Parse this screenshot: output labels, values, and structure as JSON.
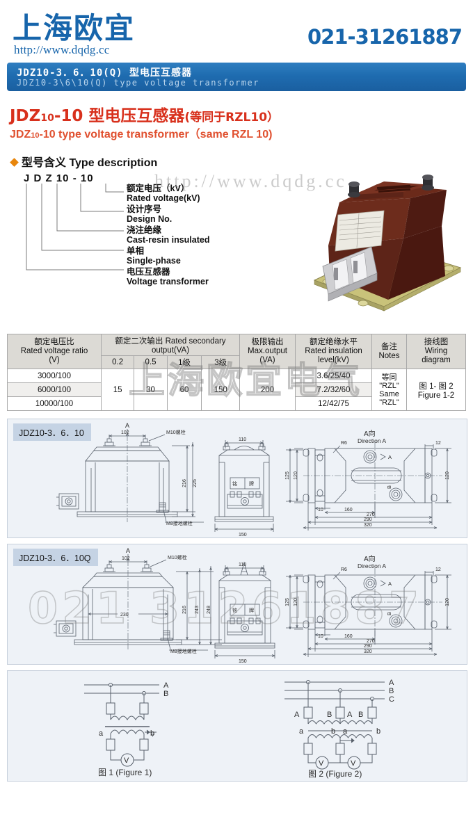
{
  "header": {
    "company_cn": "上海欧宜",
    "website": "http://www.dqdg.cc",
    "phone": "021-31261887",
    "brand_color": "#1765ab"
  },
  "bluebar": {
    "title_cn": "JDZ10-3．6．10(Q)  型电压互感器",
    "title_en": "JDZ10-3\\6\\10(Q)  type  voltage  transformer",
    "bg_color": "#1f6cb0"
  },
  "product": {
    "title_cn_prefix": "JDZ",
    "title_cn_sub": "10",
    "title_cn_main": "-10  型电压互感器",
    "title_cn_tail": "(等同于RZL10）",
    "title_en_prefix": "JDZ",
    "title_en_sub": "10",
    "title_en_main": "-10  type voltage  transformer（same RZL 10)",
    "title_color": "#d8301c"
  },
  "type_description": {
    "heading": "型号含义 Type description",
    "code": "J   D   Z  10  -   10",
    "items": [
      {
        "cn": "额定电压（kV）",
        "en": "Rated voltage(kV)"
      },
      {
        "cn": "设计序号",
        "en": "Design No."
      },
      {
        "cn": "浇注绝缘",
        "en": "Cast-resin insulated"
      },
      {
        "cn": "单相",
        "en": "Single-phase"
      },
      {
        "cn": "电压互感器",
        "en": "Voltage transformer"
      }
    ]
  },
  "watermarks": {
    "url": "http://www.dqdg.cc",
    "phone": "021 31261887",
    "company": "上海欧宜电气"
  },
  "spec_table": {
    "headers": {
      "ratio_cn": "额定电压比",
      "ratio_en": "Rated voltage ratio",
      "ratio_unit": "(V)",
      "secondary_output": "额定二次输出 Rated secondary output(VA)",
      "classes": [
        "0.2",
        "0.5",
        "1级",
        "3级"
      ],
      "max_output_cn": "极限输出",
      "max_output_en": "Max.output",
      "max_output_unit": "(VA)",
      "insulation_cn": "额定绝缘水平",
      "insulation_en": "Rated insulation",
      "insulation_unit": "level(kV)",
      "notes_cn": "备注",
      "notes_en": "Notes",
      "wiring_cn": "接线图",
      "wiring_en1": "Wiring",
      "wiring_en2": "diagram"
    },
    "rows": [
      {
        "ratio": "3000/100",
        "insulation": "3.6/25/40"
      },
      {
        "ratio": "6000/100",
        "insulation": "7.2/32/60"
      },
      {
        "ratio": "10000/100",
        "insulation": "12/42/75"
      }
    ],
    "merged": {
      "class_02": "15",
      "class_05": "30",
      "class_1": "60",
      "class_3": "150",
      "max_output": "200",
      "notes_line1": "等同",
      "notes_line2": "\"RZL\"",
      "notes_line3": "Same",
      "notes_line4": "\"RZL\"",
      "wiring_line1": "图 1- 图 2",
      "wiring_line2": "Figure 1-2"
    }
  },
  "drawing_panel_1": {
    "label": "JDZ10-3．6．10",
    "front_view": {
      "marker_a": "A",
      "dim_102": "102",
      "bolt_label": "M10螺栓",
      "dim_216": "216",
      "dim_225": "225",
      "ground_label": "M8接地螺栓"
    },
    "side_view": {
      "dim_110": "110",
      "nameplate": "铭   牌",
      "dim_150": "150"
    },
    "top_view": {
      "direction_cn": "A向",
      "direction_en": "Direction A",
      "r6": "R6",
      "dim_12": "12",
      "dim_125": "125",
      "dim_120_left": "120",
      "dim_120_right": "120",
      "dim_10": "10",
      "dim_160": "160",
      "dim_270": "270",
      "dim_290": "290",
      "dim_320": "320",
      "label_a": "A",
      "label_b": "B"
    }
  },
  "drawing_panel_2": {
    "label": "JDZ10-3．6．10Q",
    "front_view": {
      "marker_a": "A",
      "dim_102": "102",
      "bolt_label": "M10螺栓",
      "dim_230": "230",
      "dim_216": "216",
      "dim_243": "243",
      "dim_248": "248",
      "ground_label": "M8接地螺栓"
    },
    "side_view": {
      "dim_110": "110",
      "nameplate": "铭   牌",
      "dim_150": "150"
    },
    "top_view": {
      "direction_cn": "A向",
      "direction_en": "Direction A",
      "r6": "R6",
      "dim_12": "12",
      "dim_125": "125",
      "dim_120_left": "120",
      "dim_120_right": "120",
      "dim_10": "10",
      "dim_160": "160",
      "dim_270": "270",
      "dim_290": "290",
      "dim_320": "320",
      "label_a": "A",
      "label_b": "B"
    }
  },
  "wiring_diagrams": {
    "figure1": {
      "caption": "图 1 (Figure 1)",
      "lines": [
        "A",
        "B"
      ],
      "secondary": [
        "a",
        "b"
      ],
      "meter": "V"
    },
    "figure2": {
      "caption": "图 2 (Figure 2)",
      "lines": [
        "A",
        "B",
        "C"
      ],
      "primary_terminals": [
        "A",
        "B",
        "A",
        "B"
      ],
      "secondary_terminals": [
        "a",
        "b",
        "a",
        "b"
      ],
      "meters": [
        "V",
        "V"
      ]
    }
  }
}
